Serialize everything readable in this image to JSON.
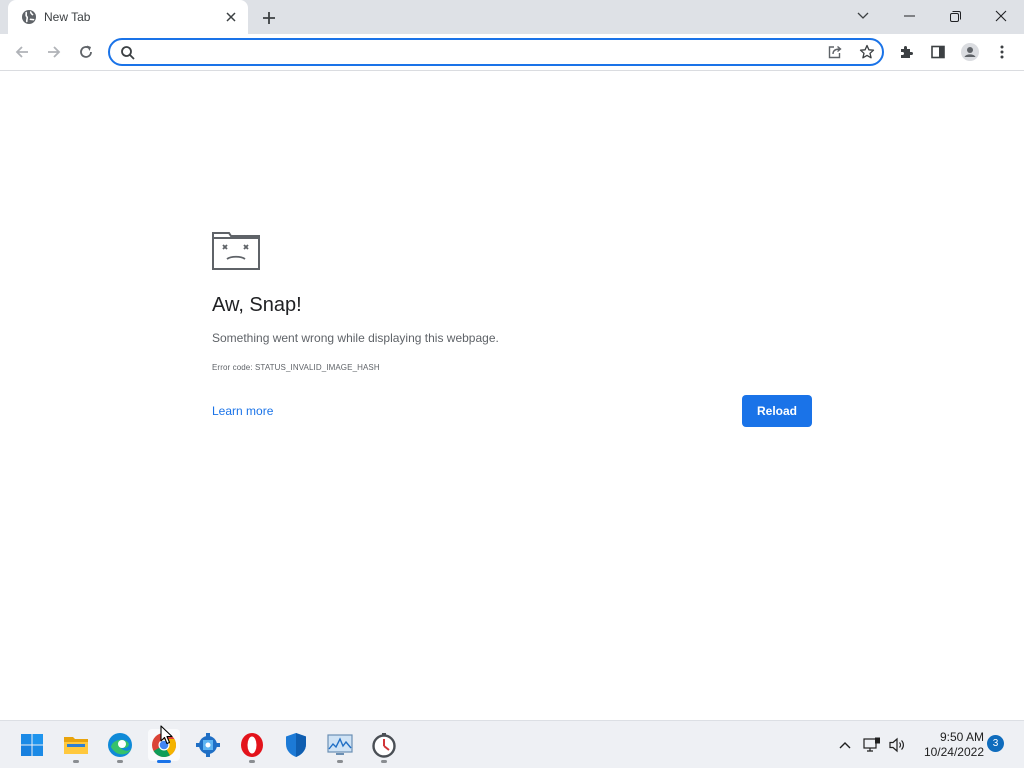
{
  "browser": {
    "tab": {
      "title": "New Tab"
    },
    "omnibox": {
      "value": "",
      "placeholder": ""
    }
  },
  "error_page": {
    "title": "Aw, Snap!",
    "description": "Something went wrong while displaying this webpage.",
    "error_code": "Error code: STATUS_INVALID_IMAGE_HASH",
    "learn_more_label": "Learn more",
    "reload_label": "Reload"
  },
  "taskbar": {
    "apps": [
      "start",
      "file-explorer",
      "edge",
      "chrome",
      "app-4",
      "opera",
      "defender",
      "resource-monitor",
      "clock-app"
    ],
    "active_app": "chrome",
    "time": "9:50 AM",
    "date": "10/24/2022",
    "notification_count": "3"
  },
  "colors": {
    "accent": "#1a73e8",
    "tabstrip_bg": "#dee1e6",
    "taskbar_bg": "#eef0f4"
  }
}
